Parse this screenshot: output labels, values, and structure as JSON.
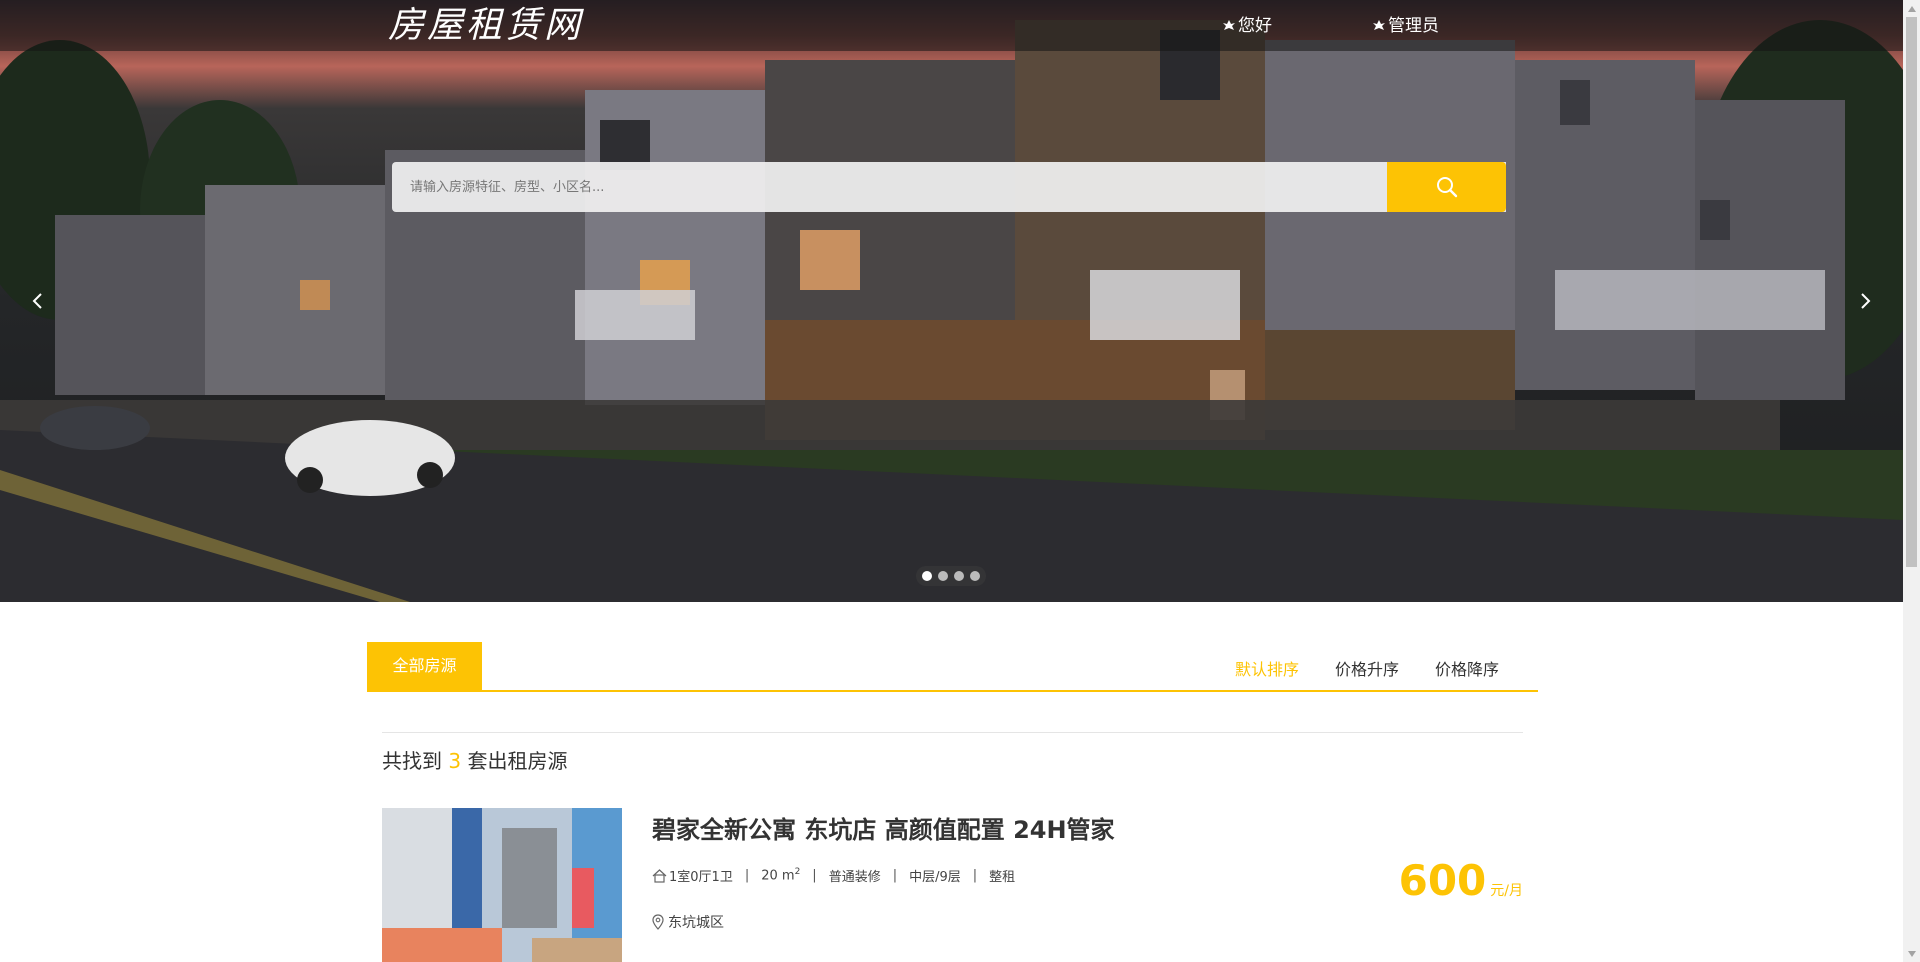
{
  "header": {
    "logo_text": "房屋租赁网",
    "nav": [
      {
        "label": "您好"
      },
      {
        "label": "管理员"
      }
    ]
  },
  "search": {
    "placeholder": "请输入房源特征、房型、小区名..."
  },
  "carousel": {
    "slide_count": 4,
    "active_index": 0
  },
  "tabs": {
    "active_label": "全部房源",
    "sort_options": [
      {
        "label": "默认排序",
        "active": true
      },
      {
        "label": "价格升序",
        "active": false
      },
      {
        "label": "价格降序",
        "active": false
      }
    ]
  },
  "results": {
    "prefix": "共找到",
    "count": "3",
    "suffix": "套出租房源"
  },
  "listings": [
    {
      "title": "碧家全新公寓 东坑店 高颜值配置 24H管家",
      "layout": "1室0厅1卫",
      "area": "20 m",
      "area_sup": "2",
      "decoration": "普通装修",
      "floor": "中层/9层",
      "rent_type": "整租",
      "location": "东坑城区",
      "price": "600",
      "price_unit": "元/月"
    }
  ],
  "colors": {
    "accent": "#fdc304",
    "text": "#333333"
  }
}
